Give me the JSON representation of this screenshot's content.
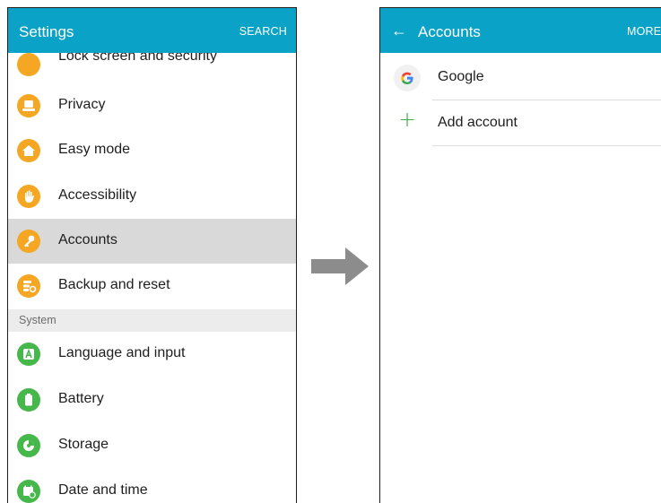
{
  "settings_screen": {
    "title": "Settings",
    "action_label": "SEARCH",
    "items_top": [
      {
        "label": "Lock screen and security",
        "icon": "lock-icon",
        "color": "#f5a623"
      },
      {
        "label": "Privacy",
        "icon": "privacy-icon",
        "color": "#f5a623"
      },
      {
        "label": "Easy mode",
        "icon": "easy-mode-home-icon",
        "color": "#f5a623"
      },
      {
        "label": "Accessibility",
        "icon": "accessibility-hand-icon",
        "color": "#f5a623"
      },
      {
        "label": "Accounts",
        "icon": "accounts-key-icon",
        "color": "#f5a623",
        "selected": true
      },
      {
        "label": "Backup and reset",
        "icon": "backup-icon",
        "color": "#f5a623"
      }
    ],
    "section_header": "System",
    "items_system": [
      {
        "label": "Language and input",
        "icon": "language-icon",
        "color": "#46b74a"
      },
      {
        "label": "Battery",
        "icon": "battery-icon",
        "color": "#46b74a"
      },
      {
        "label": "Storage",
        "icon": "storage-icon",
        "color": "#46b74a"
      },
      {
        "label": "Date and time",
        "icon": "calendar-clock-icon",
        "color": "#46b74a"
      }
    ]
  },
  "accounts_screen": {
    "title": "Accounts",
    "action_label": "MORE",
    "back_icon": "back-arrow-icon",
    "items": [
      {
        "label": "Google",
        "icon": "google-icon"
      },
      {
        "label": "Add account",
        "icon": "plus-icon"
      }
    ]
  },
  "colors": {
    "app_bar": "#0aa2c6",
    "selected_row": "#d9d9d9",
    "section_header_bg": "#ececec",
    "security_icons": "#f5a623",
    "system_icons": "#46b74a",
    "flow_arrow": "#8c8c8c"
  }
}
